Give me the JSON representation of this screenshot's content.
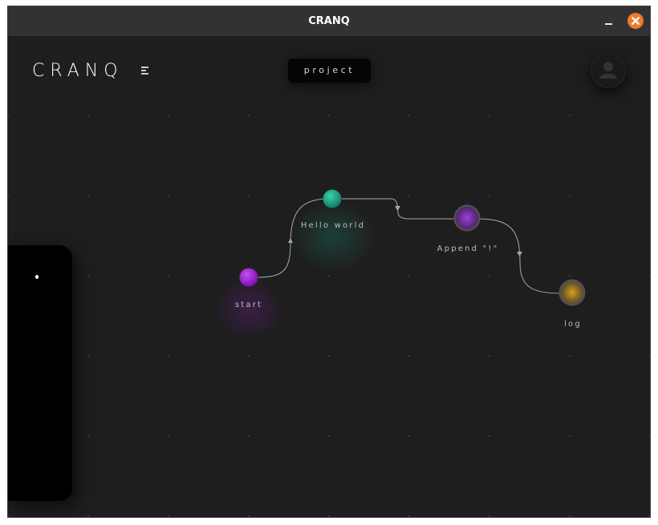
{
  "window": {
    "title": "CRANQ"
  },
  "logo": {
    "text": "CRANQ"
  },
  "header": {
    "project_label": "project"
  },
  "nodes": [
    {
      "id": "start",
      "label": "start",
      "color": "#a020d6"
    },
    {
      "id": "hello",
      "label": "Hello world",
      "color": "#1aa083"
    },
    {
      "id": "append",
      "label": "Append \"!\"",
      "color": "#8a2fc0"
    },
    {
      "id": "log",
      "label": "log",
      "color": "#b88a1a"
    }
  ],
  "icons": {
    "menu": "menu-icon",
    "avatar": "user-icon",
    "minimize": "minimize-icon",
    "close": "close-icon"
  },
  "colors": {
    "background": "#1e1e1e",
    "titlebar": "#323232",
    "close_button": "#ef7b2a",
    "connector": "#a8a8a8"
  }
}
